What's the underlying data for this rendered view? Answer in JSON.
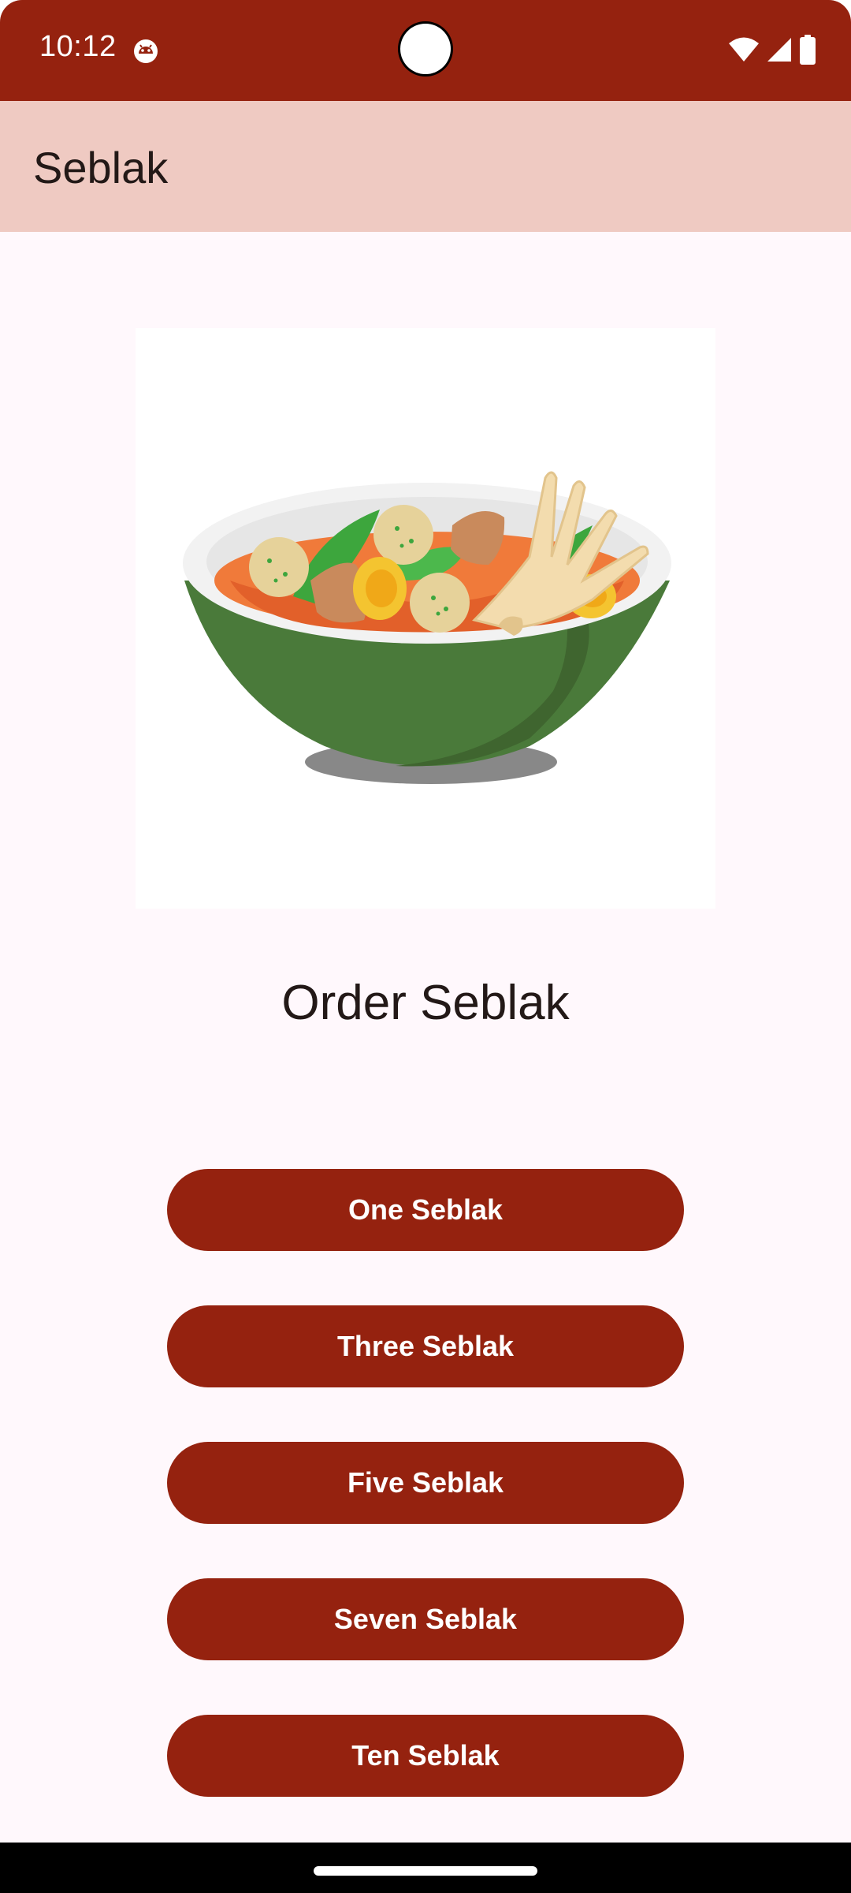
{
  "status_bar": {
    "time": "10:12",
    "app_icon": "android-face-icon",
    "icons": [
      "wifi-icon",
      "signal-icon",
      "battery-icon"
    ]
  },
  "app_bar": {
    "title": "Seblak"
  },
  "main": {
    "image": "seblak-bowl-image",
    "title": "Order Seblak",
    "buttons": [
      {
        "label": "One Seblak"
      },
      {
        "label": "Three Seblak"
      },
      {
        "label": "Five Seblak"
      },
      {
        "label": "Seven Seblak"
      },
      {
        "label": "Ten Seblak"
      }
    ]
  },
  "colors": {
    "primary": "#95220f",
    "app_bar": "#efcac2",
    "background": "#fff8fc",
    "on_primary": "#ffffff",
    "on_surface": "#231917"
  }
}
